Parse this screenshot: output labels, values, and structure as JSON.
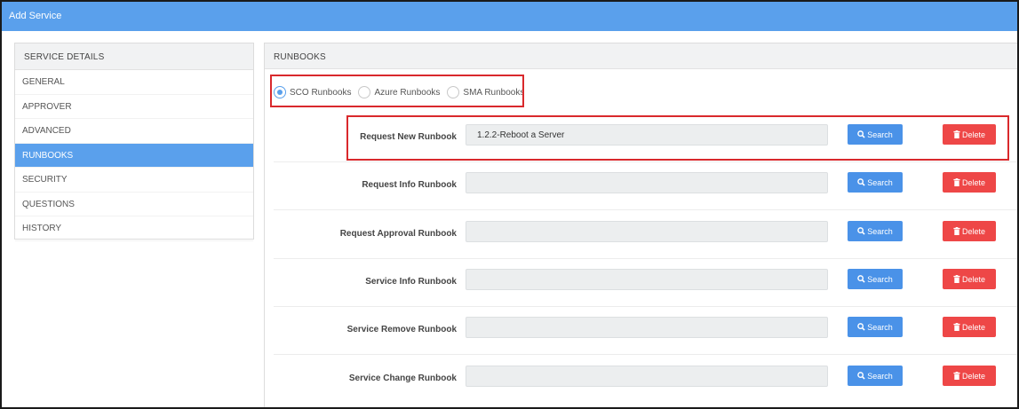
{
  "window": {
    "title": "Add Service"
  },
  "sidebar": {
    "heading": "SERVICE DETAILS",
    "items": [
      {
        "label": "GENERAL"
      },
      {
        "label": "APPROVER"
      },
      {
        "label": "ADVANCED"
      },
      {
        "label": "RUNBOOKS",
        "active": true
      },
      {
        "label": "SECURITY"
      },
      {
        "label": "QUESTIONS"
      },
      {
        "label": "HISTORY"
      }
    ]
  },
  "runbooks": {
    "heading": "RUNBOOKS",
    "types": [
      {
        "label": "SCO Runbooks",
        "selected": true
      },
      {
        "label": "Azure Runbooks",
        "selected": false
      },
      {
        "label": "SMA Runbooks",
        "selected": false
      }
    ],
    "search_label": "Search",
    "delete_label": "Delete",
    "rows": [
      {
        "label": "Request New Runbook",
        "value": "1.2.2-Reboot a Server"
      },
      {
        "label": "Request Info Runbook",
        "value": ""
      },
      {
        "label": "Request Approval Runbook",
        "value": ""
      },
      {
        "label": "Service Info Runbook",
        "value": ""
      },
      {
        "label": "Service Remove Runbook",
        "value": ""
      },
      {
        "label": "Service Change Runbook",
        "value": ""
      }
    ]
  },
  "colors": {
    "accent": "#5aa0ec",
    "search_button": "#4a92e8",
    "delete_button": "#ee4747",
    "highlight_box": "#d9292c"
  },
  "icons": {
    "search": "magnifier-icon",
    "delete": "trash-icon"
  }
}
